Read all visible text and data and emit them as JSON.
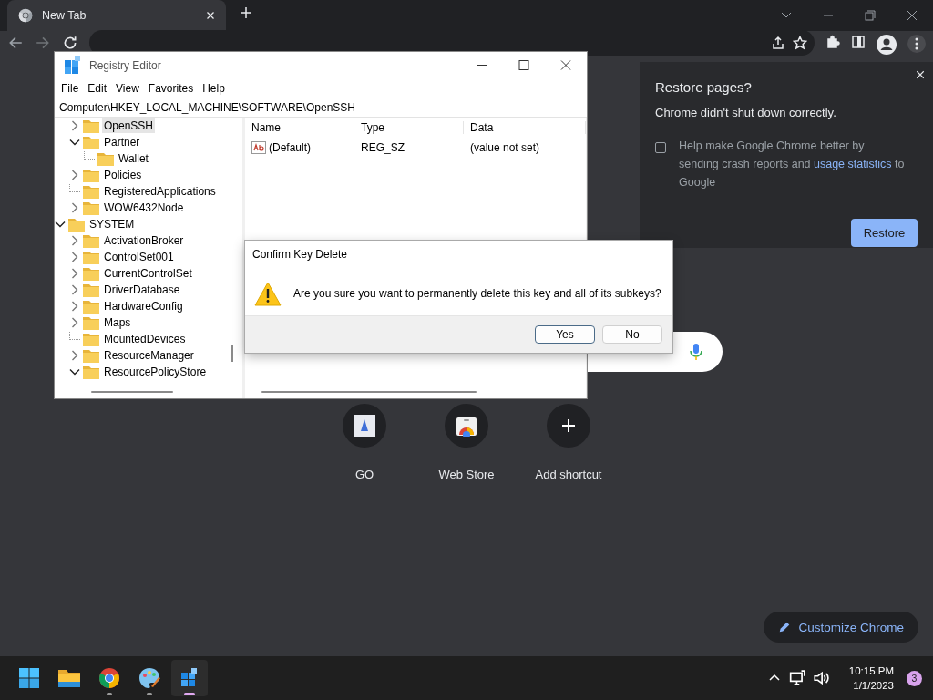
{
  "browser": {
    "tab": {
      "title": "New Tab",
      "selected": true
    }
  },
  "registry_editor": {
    "title": "Registry Editor",
    "menu": [
      "File",
      "Edit",
      "View",
      "Favorites",
      "Help"
    ],
    "address": "Computer\\HKEY_LOCAL_MACHINE\\SOFTWARE\\OpenSSH",
    "tree": [
      {
        "children": [
          {
            "name": "OpenSSH",
            "expandable": true,
            "expanded": false,
            "selected": true
          },
          {
            "name": "Partner",
            "expandable": true,
            "expanded": true,
            "selected": false,
            "children": [
              {
                "name": "Wallet",
                "expandable": false,
                "selected": false
              }
            ]
          },
          {
            "name": "Policies",
            "expandable": true,
            "expanded": false,
            "selected": false
          },
          {
            "name": "RegisteredApplications",
            "expandable": false,
            "selected": false
          },
          {
            "name": "WOW6432Node",
            "expandable": true,
            "expanded": false,
            "selected": false
          }
        ]
      },
      {
        "name": "SYSTEM",
        "expandable": true,
        "expanded": true,
        "selected": false,
        "children": [
          {
            "name": "ActivationBroker",
            "expandable": true,
            "expanded": false,
            "selected": false
          },
          {
            "name": "ControlSet001",
            "expandable": true,
            "expanded": false,
            "selected": false
          },
          {
            "name": "CurrentControlSet",
            "expandable": true,
            "expanded": false,
            "selected": false
          },
          {
            "name": "DriverDatabase",
            "expandable": true,
            "expanded": false,
            "selected": false
          },
          {
            "name": "HardwareConfig",
            "expandable": true,
            "expanded": false,
            "selected": false
          },
          {
            "name": "Maps",
            "expandable": true,
            "expanded": false,
            "selected": false
          },
          {
            "name": "MountedDevices",
            "expandable": false,
            "selected": false
          },
          {
            "name": "ResourceManager",
            "expandable": true,
            "expanded": false,
            "selected": false
          },
          {
            "name": "ResourcePolicyStore",
            "expandable": true,
            "expanded": true,
            "selected": false
          }
        ]
      }
    ],
    "columns": [
      "Name",
      "Type",
      "Data"
    ],
    "values": [
      {
        "name": "(Default)",
        "type": "REG_SZ",
        "data": "(value not set)"
      }
    ]
  },
  "dialog": {
    "title": "Confirm Key Delete",
    "message": "Are you sure you want to permanently delete this key and all of its subkeys?",
    "buttons": [
      {
        "label": "Yes",
        "selected": true
      },
      {
        "label": "No",
        "selected": false
      }
    ]
  },
  "restore_bubble": {
    "title": "Restore pages?",
    "message": "Chrome didn't shut down correctly.",
    "checkbox": {
      "checked": false,
      "text_before": "Help make Google Chrome better by sending crash reports and ",
      "link": "usage statistics",
      "text_after": " to Google"
    },
    "button": "Restore"
  },
  "shortcuts": [
    {
      "label": "GO",
      "kind": "go"
    },
    {
      "label": "Web Store",
      "kind": "store"
    },
    {
      "label": "Add shortcut",
      "kind": "add"
    }
  ],
  "customize_button": "Customize Chrome",
  "taskbar": {
    "apps": [
      {
        "kind": "start",
        "running": false,
        "active": false
      },
      {
        "kind": "explorer",
        "running": false,
        "active": false
      },
      {
        "kind": "chrome",
        "running": true,
        "active": false
      },
      {
        "kind": "paint",
        "running": true,
        "active": false
      },
      {
        "kind": "regedit",
        "running": true,
        "active": true
      }
    ],
    "time": "10:15 PM",
    "date": "1/1/2023",
    "notification_count": "3"
  }
}
